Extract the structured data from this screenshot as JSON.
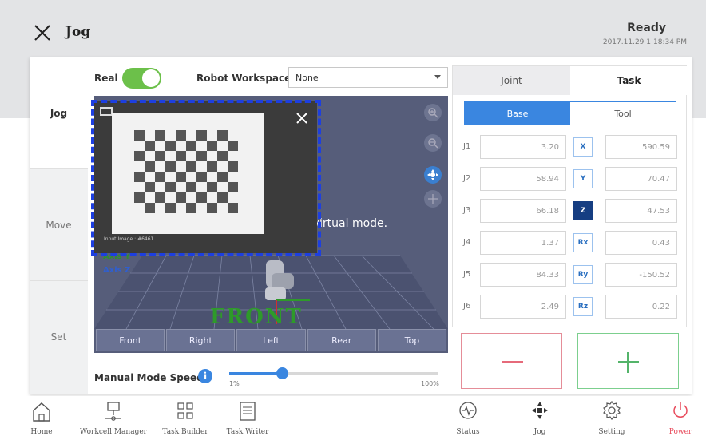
{
  "header": {
    "title": "Jog",
    "status": "Ready",
    "timestamp": "2017.11.29 1:18:34 PM"
  },
  "side_tabs": [
    {
      "label": "Jog",
      "active": true
    },
    {
      "label": "Move",
      "active": false
    },
    {
      "label": "Set",
      "active": false
    }
  ],
  "controls": {
    "real_label": "Real",
    "real_on": true,
    "workspace_label": "Robot Workspace",
    "workspace_value": "None"
  },
  "viewport": {
    "message_fragment": "n the virtual mode.",
    "axis_y": "Axis Y",
    "axis_z": "Axis Z",
    "front_label": "FRONT",
    "view_buttons": [
      "Front",
      "Right",
      "Left",
      "Rear",
      "Top"
    ]
  },
  "camera": {
    "input_label": "Input Image : #6461"
  },
  "speed": {
    "label": "Manual Mode Speed",
    "min_label": "1%",
    "max_label": "100%",
    "value_fraction": 0.25
  },
  "right_panel": {
    "tabs": [
      {
        "label": "Joint",
        "active": false
      },
      {
        "label": "Task",
        "active": true
      }
    ],
    "frame_buttons": [
      {
        "label": "Base",
        "active": true
      },
      {
        "label": "Tool",
        "active": false
      }
    ],
    "rows": [
      {
        "joint": "J1",
        "joint_value": "3.20",
        "task": "X",
        "task_value": "590.59",
        "task_active": false
      },
      {
        "joint": "J2",
        "joint_value": "58.94",
        "task": "Y",
        "task_value": "70.47",
        "task_active": false
      },
      {
        "joint": "J3",
        "joint_value": "66.18",
        "task": "Z",
        "task_value": "47.53",
        "task_active": true
      },
      {
        "joint": "J4",
        "joint_value": "1.37",
        "task": "Rx",
        "task_value": "0.43",
        "task_active": false
      },
      {
        "joint": "J5",
        "joint_value": "84.33",
        "task": "Ry",
        "task_value": "-150.52",
        "task_active": false
      },
      {
        "joint": "J6",
        "joint_value": "2.49",
        "task": "Rz",
        "task_value": "0.22",
        "task_active": false
      }
    ]
  },
  "bottom_nav": {
    "home": "Home",
    "workcell": "Workcell Manager",
    "task_builder": "Task Builder",
    "task_writer": "Task Writer",
    "status": "Status",
    "jog": "Jog",
    "setting": "Setting",
    "power": "Power"
  },
  "colors": {
    "accent_blue": "#3a86e0",
    "toggle_green": "#6cc04a",
    "power_red": "#e84b5c",
    "selection_dash": "#1d3fe0"
  }
}
